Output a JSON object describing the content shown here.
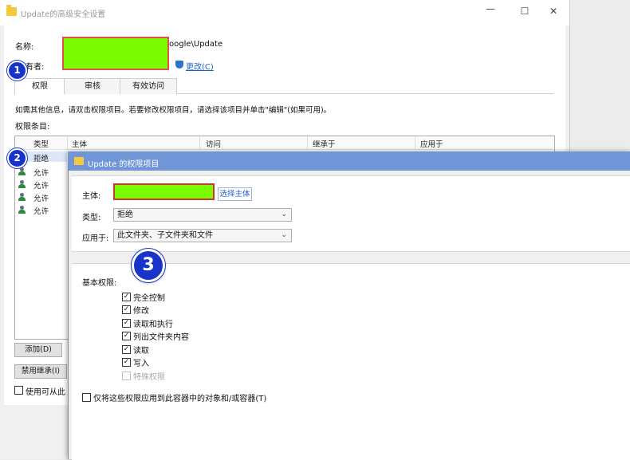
{
  "back_window": {
    "title": "Update的高级安全设置",
    "controls": {
      "minimize": "—",
      "maximize": "☐",
      "close": "✕"
    },
    "name_label": "名称:",
    "name_value_suffix": "oogle\\Update",
    "owner_label": "有者:",
    "change_link": "更改(C)",
    "tabs": [
      "权限",
      "审核",
      "有效访问"
    ],
    "info_text": "如需其他信息，请双击权限项目。若要修改权限项目，请选择该项目并单击\"编辑\"(如果可用)。",
    "entries_label": "权限条目:",
    "columns": [
      "类型",
      "主体",
      "访问",
      "继承于",
      "应用于"
    ],
    "rows": [
      {
        "type": "拒绝"
      },
      {
        "type": "允许"
      },
      {
        "type": "允许"
      },
      {
        "type": "允许"
      },
      {
        "type": "允许"
      }
    ],
    "add_button": "添加(D)",
    "disable_inherit_button": "禁用继承(I)",
    "inherit_checkbox_label": "使用可从此"
  },
  "badges": [
    "1",
    "2",
    "3"
  ],
  "front_dialog": {
    "title": "Update 的权限项目",
    "principal_label": "主体:",
    "select_principal": "选择主体",
    "type_label": "类型:",
    "type_value": "拒绝",
    "apply_label": "应用于:",
    "apply_value": "此文件夹、子文件夹和文件",
    "basic_perms_label": "基本权限:",
    "permissions": [
      {
        "label": "完全控制",
        "checked": true
      },
      {
        "label": "修改",
        "checked": true
      },
      {
        "label": "读取和执行",
        "checked": true
      },
      {
        "label": "列出文件夹内容",
        "checked": true
      },
      {
        "label": "读取",
        "checked": true
      },
      {
        "label": "写入",
        "checked": true
      },
      {
        "label": "特殊权限",
        "checked": false,
        "disabled": true
      }
    ],
    "only_apply_label": "仅将这些权限应用到此容器中的对象和/或容器(T)",
    "only_apply_checked": false,
    "check_mark": "✓",
    "chevron": "⌄"
  },
  "colors": {
    "redaction": "#7cfc00",
    "highlight_border": "#e34f48",
    "badge": "#1733c9",
    "front_titlebar": "#7096d8",
    "link": "#1f5fd1"
  }
}
